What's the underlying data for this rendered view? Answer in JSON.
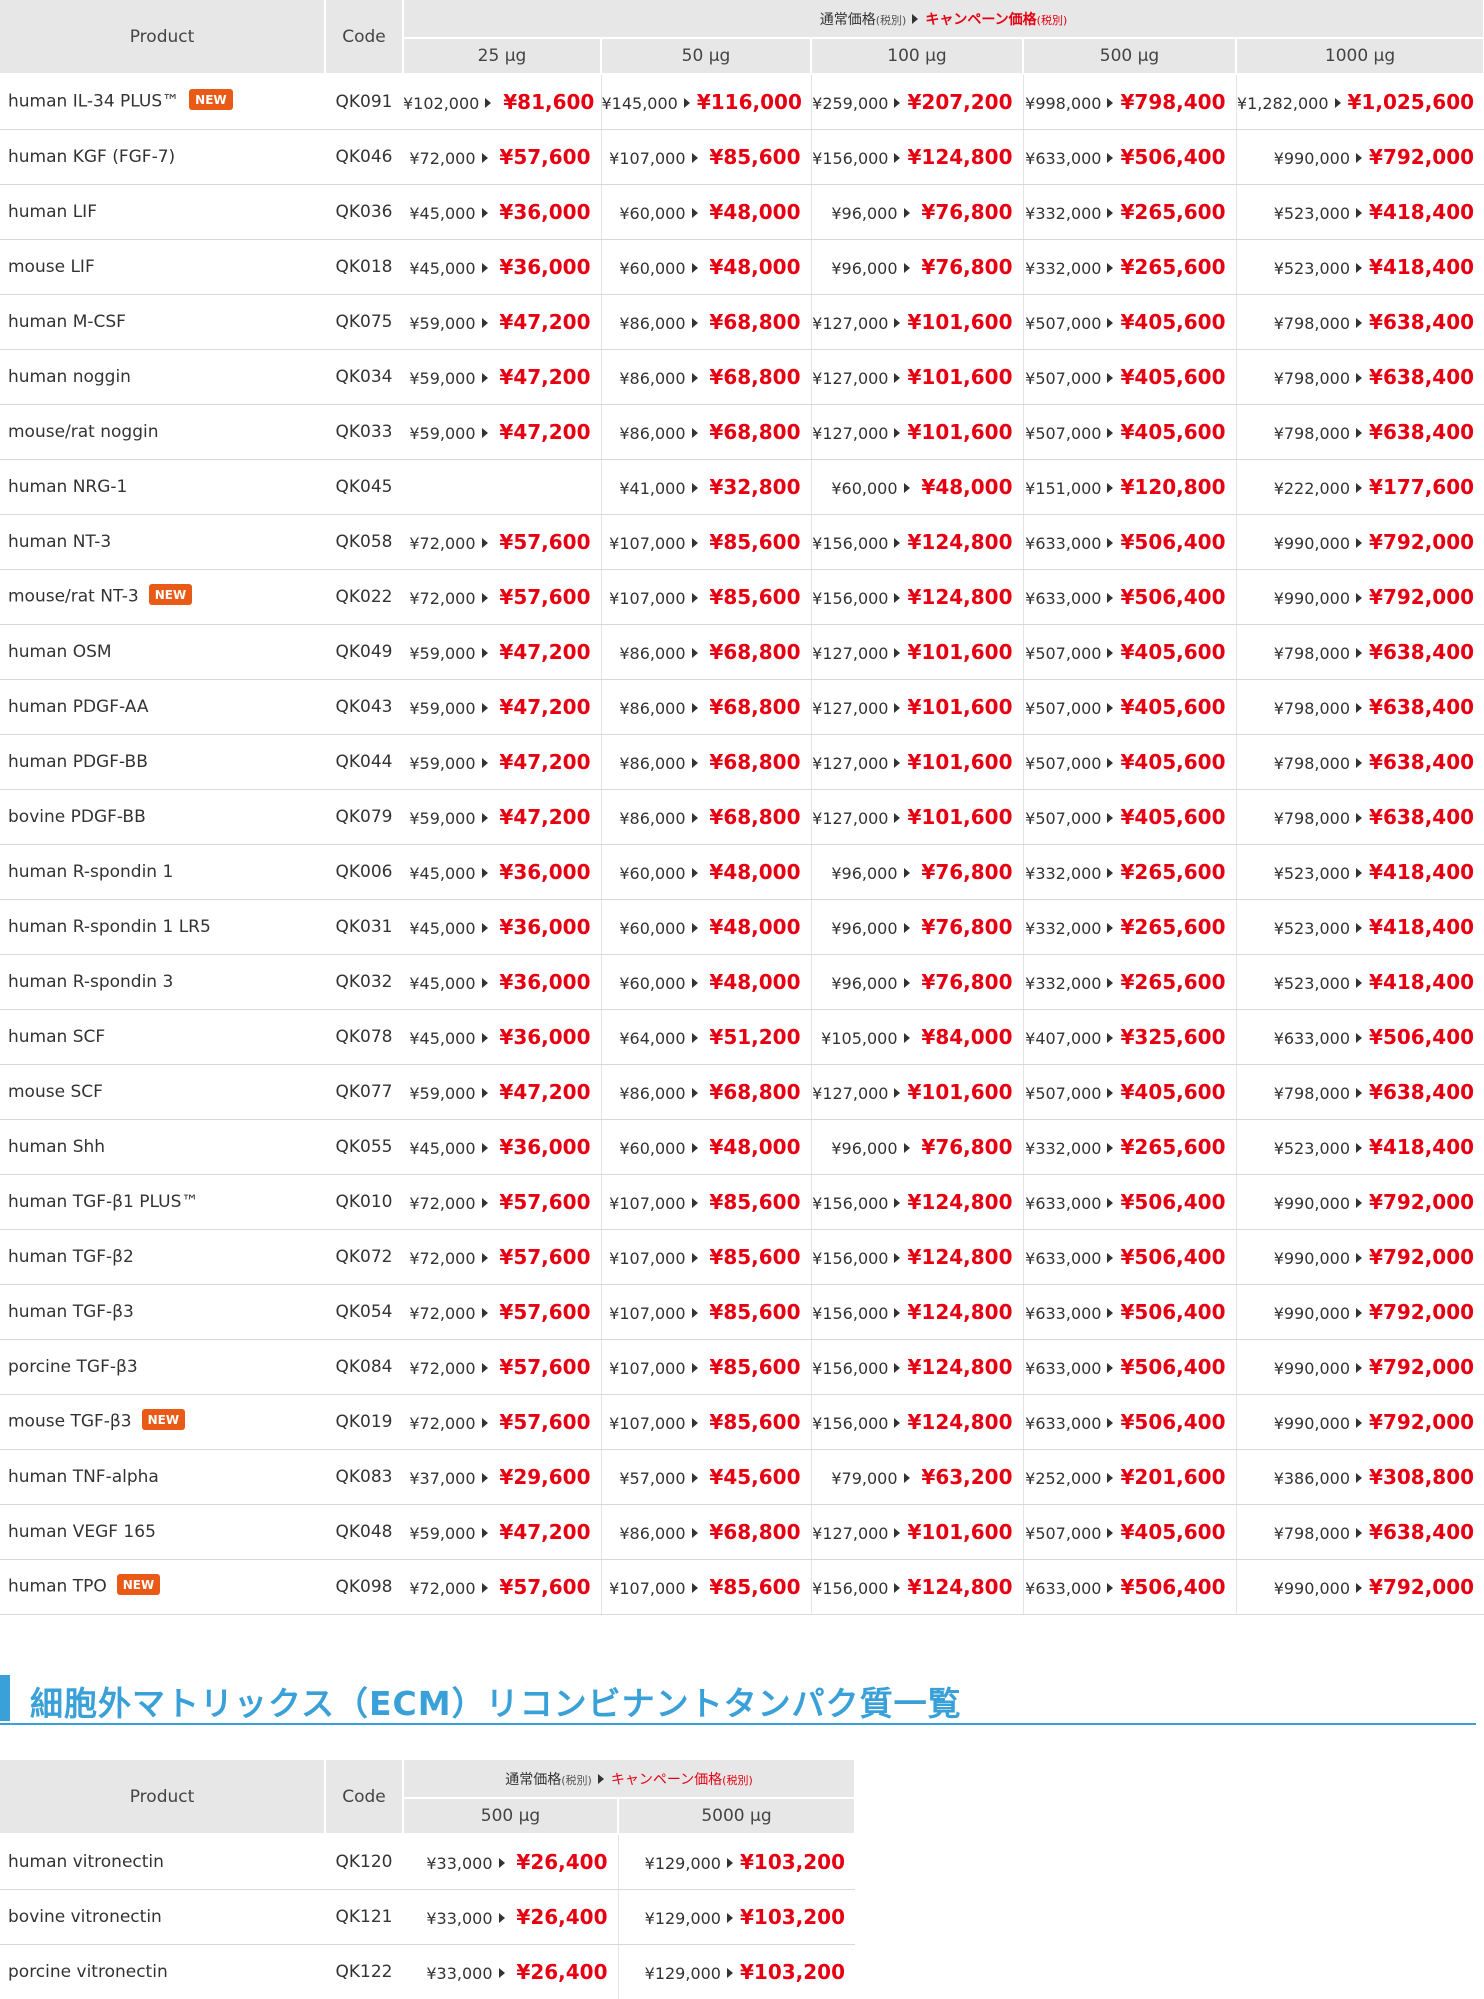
{
  "badge_label": "NEW",
  "main_table": {
    "header": {
      "product": "Product",
      "code": "Code",
      "normal_price": "通常価格",
      "tax": "(税別)",
      "campaign_price": "キャンペーン価格",
      "campaign_tax": "(税別)",
      "sizes": [
        "25 μg",
        "50 μg",
        "100 μg",
        "500 μg",
        "1000 μg"
      ]
    },
    "rows": [
      {
        "product": "human IL-34 PLUS™",
        "new": true,
        "code": "QK091",
        "prices": [
          [
            "¥102,000",
            "¥81,600"
          ],
          [
            "¥145,000",
            "¥116,000"
          ],
          [
            "¥259,000",
            "¥207,200"
          ],
          [
            "¥998,000",
            "¥798,400"
          ],
          [
            "¥1,282,000",
            "¥1,025,600"
          ]
        ]
      },
      {
        "product": "human KGF (FGF-7)",
        "new": false,
        "code": "QK046",
        "prices": [
          [
            "¥72,000",
            "¥57,600"
          ],
          [
            "¥107,000",
            "¥85,600"
          ],
          [
            "¥156,000",
            "¥124,800"
          ],
          [
            "¥633,000",
            "¥506,400"
          ],
          [
            "¥990,000",
            "¥792,000"
          ]
        ]
      },
      {
        "product": "human LIF",
        "new": false,
        "code": "QK036",
        "prices": [
          [
            "¥45,000",
            "¥36,000"
          ],
          [
            "¥60,000",
            "¥48,000"
          ],
          [
            "¥96,000",
            "¥76,800"
          ],
          [
            "¥332,000",
            "¥265,600"
          ],
          [
            "¥523,000",
            "¥418,400"
          ]
        ]
      },
      {
        "product": "mouse LIF",
        "new": false,
        "code": "QK018",
        "prices": [
          [
            "¥45,000",
            "¥36,000"
          ],
          [
            "¥60,000",
            "¥48,000"
          ],
          [
            "¥96,000",
            "¥76,800"
          ],
          [
            "¥332,000",
            "¥265,600"
          ],
          [
            "¥523,000",
            "¥418,400"
          ]
        ]
      },
      {
        "product": "human M-CSF",
        "new": false,
        "code": "QK075",
        "prices": [
          [
            "¥59,000",
            "¥47,200"
          ],
          [
            "¥86,000",
            "¥68,800"
          ],
          [
            "¥127,000",
            "¥101,600"
          ],
          [
            "¥507,000",
            "¥405,600"
          ],
          [
            "¥798,000",
            "¥638,400"
          ]
        ]
      },
      {
        "product": "human noggin",
        "new": false,
        "code": "QK034",
        "prices": [
          [
            "¥59,000",
            "¥47,200"
          ],
          [
            "¥86,000",
            "¥68,800"
          ],
          [
            "¥127,000",
            "¥101,600"
          ],
          [
            "¥507,000",
            "¥405,600"
          ],
          [
            "¥798,000",
            "¥638,400"
          ]
        ]
      },
      {
        "product": "mouse/rat noggin",
        "new": false,
        "code": "QK033",
        "prices": [
          [
            "¥59,000",
            "¥47,200"
          ],
          [
            "¥86,000",
            "¥68,800"
          ],
          [
            "¥127,000",
            "¥101,600"
          ],
          [
            "¥507,000",
            "¥405,600"
          ],
          [
            "¥798,000",
            "¥638,400"
          ]
        ]
      },
      {
        "product": "human NRG-1",
        "new": false,
        "code": "QK045",
        "prices": [
          null,
          [
            "¥41,000",
            "¥32,800"
          ],
          [
            "¥60,000",
            "¥48,000"
          ],
          [
            "¥151,000",
            "¥120,800"
          ],
          [
            "¥222,000",
            "¥177,600"
          ]
        ]
      },
      {
        "product": "human NT-3",
        "new": false,
        "code": "QK058",
        "prices": [
          [
            "¥72,000",
            "¥57,600"
          ],
          [
            "¥107,000",
            "¥85,600"
          ],
          [
            "¥156,000",
            "¥124,800"
          ],
          [
            "¥633,000",
            "¥506,400"
          ],
          [
            "¥990,000",
            "¥792,000"
          ]
        ]
      },
      {
        "product": "mouse/rat NT-3",
        "new": true,
        "code": "QK022",
        "prices": [
          [
            "¥72,000",
            "¥57,600"
          ],
          [
            "¥107,000",
            "¥85,600"
          ],
          [
            "¥156,000",
            "¥124,800"
          ],
          [
            "¥633,000",
            "¥506,400"
          ],
          [
            "¥990,000",
            "¥792,000"
          ]
        ]
      },
      {
        "product": "human OSM",
        "new": false,
        "code": "QK049",
        "prices": [
          [
            "¥59,000",
            "¥47,200"
          ],
          [
            "¥86,000",
            "¥68,800"
          ],
          [
            "¥127,000",
            "¥101,600"
          ],
          [
            "¥507,000",
            "¥405,600"
          ],
          [
            "¥798,000",
            "¥638,400"
          ]
        ]
      },
      {
        "product": "human PDGF-AA",
        "new": false,
        "code": "QK043",
        "prices": [
          [
            "¥59,000",
            "¥47,200"
          ],
          [
            "¥86,000",
            "¥68,800"
          ],
          [
            "¥127,000",
            "¥101,600"
          ],
          [
            "¥507,000",
            "¥405,600"
          ],
          [
            "¥798,000",
            "¥638,400"
          ]
        ]
      },
      {
        "product": "human PDGF-BB",
        "new": false,
        "code": "QK044",
        "prices": [
          [
            "¥59,000",
            "¥47,200"
          ],
          [
            "¥86,000",
            "¥68,800"
          ],
          [
            "¥127,000",
            "¥101,600"
          ],
          [
            "¥507,000",
            "¥405,600"
          ],
          [
            "¥798,000",
            "¥638,400"
          ]
        ]
      },
      {
        "product": "bovine PDGF-BB",
        "new": false,
        "code": "QK079",
        "prices": [
          [
            "¥59,000",
            "¥47,200"
          ],
          [
            "¥86,000",
            "¥68,800"
          ],
          [
            "¥127,000",
            "¥101,600"
          ],
          [
            "¥507,000",
            "¥405,600"
          ],
          [
            "¥798,000",
            "¥638,400"
          ]
        ]
      },
      {
        "product": "human R-spondin 1",
        "new": false,
        "code": "QK006",
        "prices": [
          [
            "¥45,000",
            "¥36,000"
          ],
          [
            "¥60,000",
            "¥48,000"
          ],
          [
            "¥96,000",
            "¥76,800"
          ],
          [
            "¥332,000",
            "¥265,600"
          ],
          [
            "¥523,000",
            "¥418,400"
          ]
        ]
      },
      {
        "product": "human R-spondin 1 LR5",
        "new": false,
        "code": "QK031",
        "prices": [
          [
            "¥45,000",
            "¥36,000"
          ],
          [
            "¥60,000",
            "¥48,000"
          ],
          [
            "¥96,000",
            "¥76,800"
          ],
          [
            "¥332,000",
            "¥265,600"
          ],
          [
            "¥523,000",
            "¥418,400"
          ]
        ]
      },
      {
        "product": "human R-spondin 3",
        "new": false,
        "code": "QK032",
        "prices": [
          [
            "¥45,000",
            "¥36,000"
          ],
          [
            "¥60,000",
            "¥48,000"
          ],
          [
            "¥96,000",
            "¥76,800"
          ],
          [
            "¥332,000",
            "¥265,600"
          ],
          [
            "¥523,000",
            "¥418,400"
          ]
        ]
      },
      {
        "product": "human SCF",
        "new": false,
        "code": "QK078",
        "prices": [
          [
            "¥45,000",
            "¥36,000"
          ],
          [
            "¥64,000",
            "¥51,200"
          ],
          [
            "¥105,000",
            "¥84,000"
          ],
          [
            "¥407,000",
            "¥325,600"
          ],
          [
            "¥633,000",
            "¥506,400"
          ]
        ]
      },
      {
        "product": "mouse SCF",
        "new": false,
        "code": "QK077",
        "prices": [
          [
            "¥59,000",
            "¥47,200"
          ],
          [
            "¥86,000",
            "¥68,800"
          ],
          [
            "¥127,000",
            "¥101,600"
          ],
          [
            "¥507,000",
            "¥405,600"
          ],
          [
            "¥798,000",
            "¥638,400"
          ]
        ]
      },
      {
        "product": "human Shh",
        "new": false,
        "code": "QK055",
        "prices": [
          [
            "¥45,000",
            "¥36,000"
          ],
          [
            "¥60,000",
            "¥48,000"
          ],
          [
            "¥96,000",
            "¥76,800"
          ],
          [
            "¥332,000",
            "¥265,600"
          ],
          [
            "¥523,000",
            "¥418,400"
          ]
        ]
      },
      {
        "product": "human TGF-β1 PLUS™",
        "new": false,
        "code": "QK010",
        "prices": [
          [
            "¥72,000",
            "¥57,600"
          ],
          [
            "¥107,000",
            "¥85,600"
          ],
          [
            "¥156,000",
            "¥124,800"
          ],
          [
            "¥633,000",
            "¥506,400"
          ],
          [
            "¥990,000",
            "¥792,000"
          ]
        ]
      },
      {
        "product": "human TGF-β2",
        "new": false,
        "code": "QK072",
        "prices": [
          [
            "¥72,000",
            "¥57,600"
          ],
          [
            "¥107,000",
            "¥85,600"
          ],
          [
            "¥156,000",
            "¥124,800"
          ],
          [
            "¥633,000",
            "¥506,400"
          ],
          [
            "¥990,000",
            "¥792,000"
          ]
        ]
      },
      {
        "product": "human TGF-β3",
        "new": false,
        "code": "QK054",
        "prices": [
          [
            "¥72,000",
            "¥57,600"
          ],
          [
            "¥107,000",
            "¥85,600"
          ],
          [
            "¥156,000",
            "¥124,800"
          ],
          [
            "¥633,000",
            "¥506,400"
          ],
          [
            "¥990,000",
            "¥792,000"
          ]
        ]
      },
      {
        "product": "porcine TGF-β3",
        "new": false,
        "code": "QK084",
        "prices": [
          [
            "¥72,000",
            "¥57,600"
          ],
          [
            "¥107,000",
            "¥85,600"
          ],
          [
            "¥156,000",
            "¥124,800"
          ],
          [
            "¥633,000",
            "¥506,400"
          ],
          [
            "¥990,000",
            "¥792,000"
          ]
        ]
      },
      {
        "product": "mouse TGF-β3",
        "new": true,
        "code": "QK019",
        "prices": [
          [
            "¥72,000",
            "¥57,600"
          ],
          [
            "¥107,000",
            "¥85,600"
          ],
          [
            "¥156,000",
            "¥124,800"
          ],
          [
            "¥633,000",
            "¥506,400"
          ],
          [
            "¥990,000",
            "¥792,000"
          ]
        ]
      },
      {
        "product": "human TNF-alpha",
        "new": false,
        "code": "QK083",
        "prices": [
          [
            "¥37,000",
            "¥29,600"
          ],
          [
            "¥57,000",
            "¥45,600"
          ],
          [
            "¥79,000",
            "¥63,200"
          ],
          [
            "¥252,000",
            "¥201,600"
          ],
          [
            "¥386,000",
            "¥308,800"
          ]
        ]
      },
      {
        "product": "human VEGF 165",
        "new": false,
        "code": "QK048",
        "prices": [
          [
            "¥59,000",
            "¥47,200"
          ],
          [
            "¥86,000",
            "¥68,800"
          ],
          [
            "¥127,000",
            "¥101,600"
          ],
          [
            "¥507,000",
            "¥405,600"
          ],
          [
            "¥798,000",
            "¥638,400"
          ]
        ]
      },
      {
        "product": "human TPO",
        "new": true,
        "code": "QK098",
        "prices": [
          [
            "¥72,000",
            "¥57,600"
          ],
          [
            "¥107,000",
            "¥85,600"
          ],
          [
            "¥156,000",
            "¥124,800"
          ],
          [
            "¥633,000",
            "¥506,400"
          ],
          [
            "¥990,000",
            "¥792,000"
          ]
        ]
      }
    ]
  },
  "ecm_section": {
    "title": "細胞外マトリックス（ECM）リコンビナントタンパク質一覧",
    "accent_color": "#3aa0d8"
  },
  "ecm_table": {
    "header": {
      "product": "Product",
      "code": "Code",
      "normal_price": "通常価格",
      "tax": "(税別)",
      "campaign_price": "キャンペーン価格",
      "campaign_tax": "(税別)",
      "sizes": [
        "500 μg",
        "5000 μg"
      ]
    },
    "rows": [
      {
        "product": "human vitronectin",
        "new": false,
        "code": "QK120",
        "prices": [
          [
            "¥33,000",
            "¥26,400"
          ],
          [
            "¥129,000",
            "¥103,200"
          ]
        ]
      },
      {
        "product": "bovine vitronectin",
        "new": false,
        "code": "QK121",
        "prices": [
          [
            "¥33,000",
            "¥26,400"
          ],
          [
            "¥129,000",
            "¥103,200"
          ]
        ]
      },
      {
        "product": "porcine vitronectin",
        "new": false,
        "code": "QK122",
        "prices": [
          [
            "¥33,000",
            "¥26,400"
          ],
          [
            "¥129,000",
            "¥103,200"
          ]
        ]
      }
    ]
  },
  "colors": {
    "campaign_red": "#e60012",
    "header_bg": "#e7e7e7",
    "badge_orange": "#e85a16",
    "section_blue": "#3aa0d8"
  }
}
